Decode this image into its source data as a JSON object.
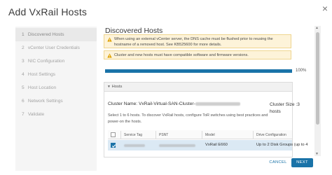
{
  "dialog": {
    "title": "Add VxRail Hosts",
    "close_icon": "close-icon"
  },
  "steps": [
    {
      "num": "1",
      "label": "Discovered Hosts",
      "active": true
    },
    {
      "num": "2",
      "label": "vCenter User Credentials",
      "active": false
    },
    {
      "num": "3",
      "label": "NIC Configuration",
      "active": false
    },
    {
      "num": "4",
      "label": "Host Settings",
      "active": false
    },
    {
      "num": "5",
      "label": "Host Location",
      "active": false
    },
    {
      "num": "6",
      "label": "Network Settings",
      "active": false
    },
    {
      "num": "7",
      "label": "Validate",
      "active": false
    }
  ],
  "main": {
    "title": "Discovered Hosts",
    "alerts": [
      {
        "icon": "warning-icon",
        "text": "When using an external vCenter server, the DNS cache must be flushed prior to reusing the hostname of a removed host. See KB525600 for more details."
      },
      {
        "icon": "warning-icon",
        "text": "Cluster and new hosts must have compatible software and firmware versions."
      }
    ],
    "progress": {
      "value": 1.0,
      "label": "100%"
    },
    "hosts": {
      "header": "Hosts",
      "cluster_name_prefix": "Cluster Name: VxRail-Virtual-SAN-Cluster-",
      "cluster_size_label": "Cluster Size :3",
      "cluster_size_unit": "hosts",
      "description": "Select 1 to 6 hosts. To discover VxRail hosts, configure ToR switches using best practices and power-on the hosts.",
      "columns": [
        "Service Tag",
        "PSNT",
        "Model",
        "Drive Configuration"
      ],
      "rows": [
        {
          "checked": true,
          "model": "VxRail E660",
          "drive_config": "Up to 2 Disk Groups (up to 4"
        }
      ]
    }
  },
  "footer": {
    "cancel_label": "CANCEL",
    "next_label": "NEXT"
  }
}
